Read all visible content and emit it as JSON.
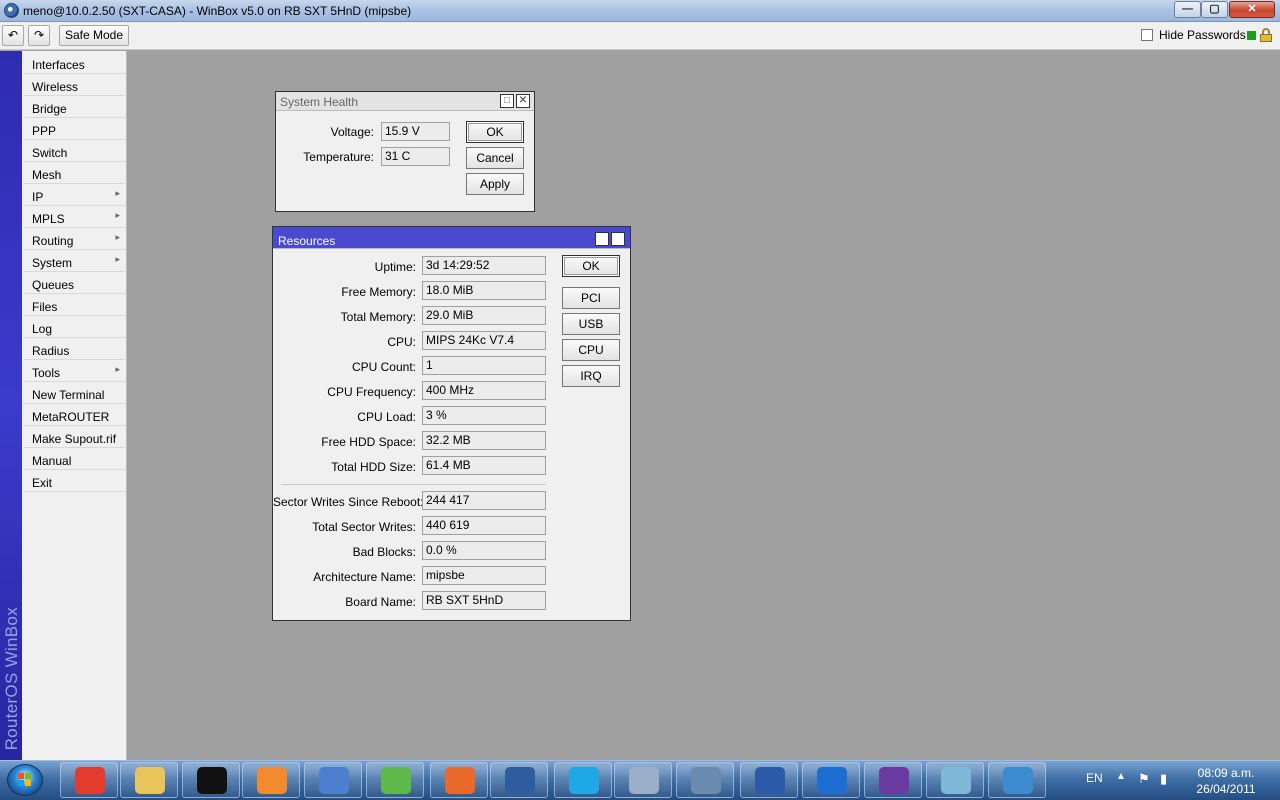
{
  "window": {
    "title": "meno@10.0.2.50 (SXT-CASA) - WinBox v5.0 on RB SXT 5HnD (mipsbe)",
    "minimize_glyph": "—",
    "maximize_glyph": "▢",
    "close_glyph": "✕"
  },
  "toolbar": {
    "undo_glyph": "↶",
    "redo_glyph": "↷",
    "safe_mode_label": "Safe Mode",
    "hide_passwords_label": "Hide Passwords"
  },
  "brand_text": "RouterOS WinBox",
  "menu": {
    "items": [
      {
        "label": "Interfaces",
        "arrow": ""
      },
      {
        "label": "Wireless",
        "arrow": ""
      },
      {
        "label": "Bridge",
        "arrow": ""
      },
      {
        "label": "PPP",
        "arrow": ""
      },
      {
        "label": "Switch",
        "arrow": ""
      },
      {
        "label": "Mesh",
        "arrow": ""
      },
      {
        "label": "IP",
        "arrow": "▸"
      },
      {
        "label": "MPLS",
        "arrow": "▸"
      },
      {
        "label": "Routing",
        "arrow": "▸"
      },
      {
        "label": "System",
        "arrow": "▸"
      },
      {
        "label": "Queues",
        "arrow": ""
      },
      {
        "label": "Files",
        "arrow": ""
      },
      {
        "label": "Log",
        "arrow": ""
      },
      {
        "label": "Radius",
        "arrow": ""
      },
      {
        "label": "Tools",
        "arrow": "▸"
      },
      {
        "label": "New Terminal",
        "arrow": ""
      },
      {
        "label": "MetaROUTER",
        "arrow": ""
      },
      {
        "label": "Make Supout.rif",
        "arrow": ""
      },
      {
        "label": "Manual",
        "arrow": ""
      },
      {
        "label": "Exit",
        "arrow": ""
      }
    ]
  },
  "system_health": {
    "title": "System Health",
    "fields": [
      {
        "label": "Voltage:",
        "value": "15.9 V"
      },
      {
        "label": "Temperature:",
        "value": "31 C"
      }
    ],
    "buttons": {
      "ok": "OK",
      "cancel": "Cancel",
      "apply": "Apply"
    }
  },
  "resources": {
    "title": "Resources",
    "fields": [
      {
        "label": "Uptime:",
        "value": "3d 14:29:52"
      },
      {
        "label": "Free Memory:",
        "value": "18.0 MiB"
      },
      {
        "label": "Total Memory:",
        "value": "29.0 MiB"
      },
      {
        "label": "CPU:",
        "value": "MIPS 24Kc V7.4"
      },
      {
        "label": "CPU Count:",
        "value": "1"
      },
      {
        "label": "CPU Frequency:",
        "value": "400 MHz"
      },
      {
        "label": "CPU Load:",
        "value": "3 %"
      },
      {
        "label": "Free HDD Space:",
        "value": "32.2 MB"
      },
      {
        "label": "Total HDD Size:",
        "value": "61.4 MB"
      },
      {
        "label": "Sector Writes Since Reboot:",
        "value": "244 417"
      },
      {
        "label": "Total Sector Writes:",
        "value": "440 619"
      },
      {
        "label": "Bad Blocks:",
        "value": "0.0 %"
      },
      {
        "label": "Architecture Name:",
        "value": "mipsbe"
      },
      {
        "label": "Board Name:",
        "value": "RB SXT 5HnD"
      }
    ],
    "buttons": {
      "ok": "OK",
      "pci": "PCI",
      "usb": "USB",
      "cpu": "CPU",
      "irq": "IRQ"
    }
  },
  "taskbar": {
    "apps": [
      {
        "icon": "chrome-icon",
        "color": "#e33b2e"
      },
      {
        "icon": "explorer-icon",
        "color": "#e9c45a"
      },
      {
        "icon": "cmd-icon",
        "color": "#111111"
      },
      {
        "icon": "media-player-icon",
        "color": "#f28a2e"
      },
      {
        "icon": "network-icon",
        "color": "#4d7fd1"
      },
      {
        "icon": "messenger-icon",
        "color": "#5fb84a"
      },
      {
        "icon": "firefox-icon",
        "color": "#e8692a"
      },
      {
        "icon": "winbox-icon",
        "color": "#2f5c9e"
      },
      {
        "icon": "skype-icon",
        "color": "#1ea9e6"
      },
      {
        "icon": "calculator-icon",
        "color": "#9aaec8"
      },
      {
        "icon": "lock-app-icon",
        "color": "#6b8ab0"
      },
      {
        "icon": "word-icon",
        "color": "#2b5aa8"
      },
      {
        "icon": "teamviewer-icon",
        "color": "#1c6ed2"
      },
      {
        "icon": "bittorrent-icon",
        "color": "#6b3aa0"
      },
      {
        "icon": "notes-icon",
        "color": "#7fb7d8"
      },
      {
        "icon": "control-panel-icon",
        "color": "#3c8ad0"
      }
    ],
    "language": "EN",
    "time": "08:09 a.m.",
    "date": "26/04/2011"
  }
}
